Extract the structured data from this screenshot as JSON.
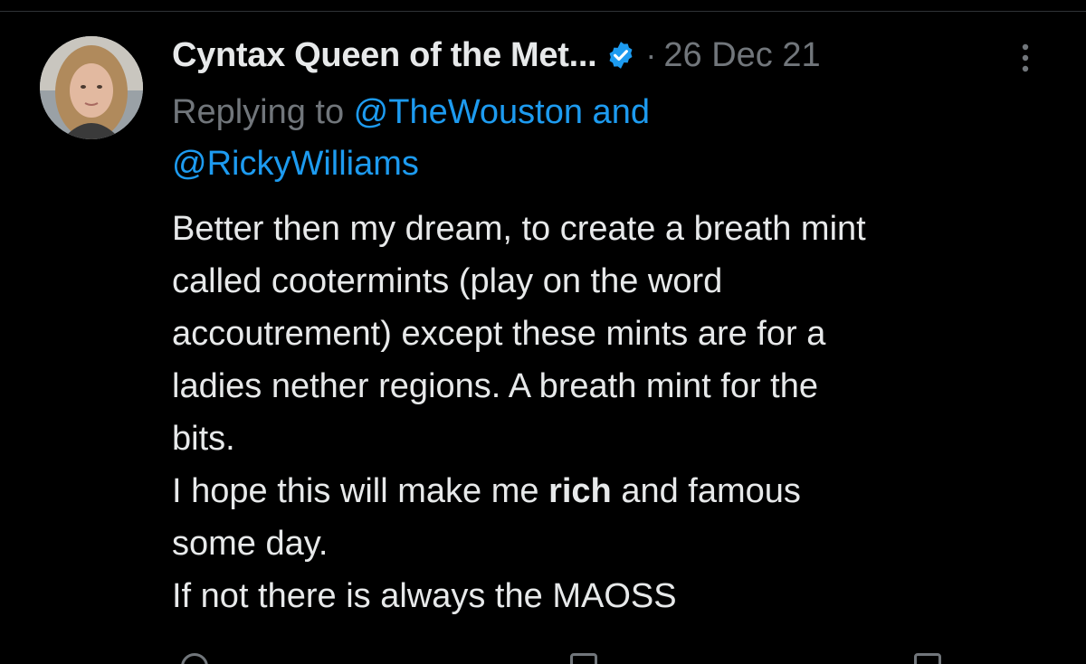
{
  "tweet": {
    "author_name": "Cyntax Queen of the Met...",
    "separator": "·",
    "date": "26 Dec 21",
    "replying_prefix": "Replying to ",
    "mention_1": "@TheWouston",
    "replying_and": " and",
    "mention_2": "@RickyWilliams",
    "body": {
      "line_1": "Better then my dream, to create a breath mint",
      "line_2": "called cootermints (play on the word",
      "line_3": "accoutrement) except these mints are for a",
      "line_4": "ladies nether regions. A breath mint for the",
      "line_5": "bits.",
      "line_6_pre": "I hope this will make me ",
      "line_6_bold": "rich",
      "line_6_post": " and famous",
      "line_7": "some day.",
      "line_8": "If not there is always the MAOSS"
    }
  },
  "icons": {
    "avatar": "avatar-photo",
    "verified": "verified-badge-icon",
    "more": "more-options-icon"
  },
  "colors": {
    "background": "#000000",
    "primary_text": "#e7e9ea",
    "secondary_text": "#71767b",
    "mention": "#1d9bf0",
    "verified_badge": "#1d9bf0"
  }
}
